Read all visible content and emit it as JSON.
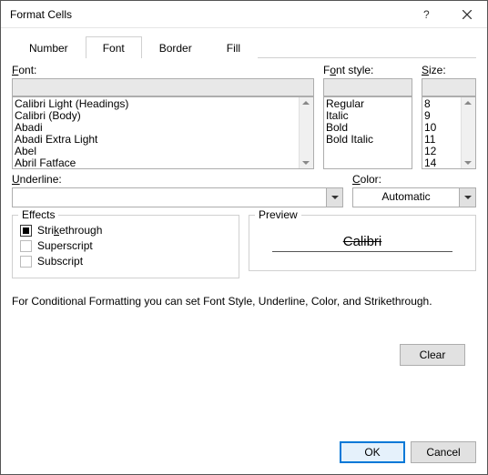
{
  "window": {
    "title": "Format Cells"
  },
  "tabs": [
    "Number",
    "Font",
    "Border",
    "Fill"
  ],
  "activeTab": "Font",
  "labels": {
    "font": "Font:",
    "style": "Font style:",
    "size": "Size:",
    "underline": "Underline:",
    "color": "Color:",
    "effects": "Effects",
    "preview": "Preview"
  },
  "fontList": [
    "Calibri Light (Headings)",
    "Calibri (Body)",
    "Abadi",
    "Abadi Extra Light",
    "Abel",
    "Abril Fatface"
  ],
  "styleList": [
    "Regular",
    "Italic",
    "Bold",
    "Bold Italic"
  ],
  "sizeList": [
    "8",
    "9",
    "10",
    "11",
    "12",
    "14"
  ],
  "underlineValue": "",
  "colorValue": "Automatic",
  "effects": {
    "strikethrough": {
      "label": "Strikethrough",
      "checked": true
    },
    "superscript": {
      "label": "Superscript",
      "checked": false
    },
    "subscript": {
      "label": "Subscript",
      "checked": false
    }
  },
  "previewSample": "Calibri",
  "description": "For Conditional Formatting you can set Font Style, Underline, Color, and Strikethrough.",
  "buttons": {
    "clear": "Clear",
    "ok": "OK",
    "cancel": "Cancel"
  }
}
